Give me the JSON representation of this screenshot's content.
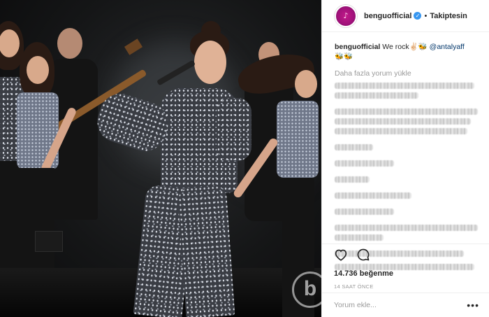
{
  "post": {
    "username": "benguofficial",
    "follow_status": "Takiptesin",
    "caption_user": "benguofficial",
    "caption_text": "We rock✌🏻🐝",
    "caption_mention": "@antalyaff",
    "caption_emoji_line": "🐝🐝",
    "load_more": "Daha fazla yorum yükle",
    "likes": "14.736 beğenme",
    "time_ago": "14 SAAT ÖNCE",
    "comment_placeholder": "Yorum ekle...",
    "more_options": "•••",
    "watermark": "b"
  },
  "icons": {
    "verified": "verified-badge-icon",
    "like": "heart-icon",
    "comment": "speech-bubble-icon"
  },
  "colors": {
    "verified": "#3897f0",
    "mention": "#003569",
    "muted": "#999999",
    "avatar": "#a0117a"
  }
}
